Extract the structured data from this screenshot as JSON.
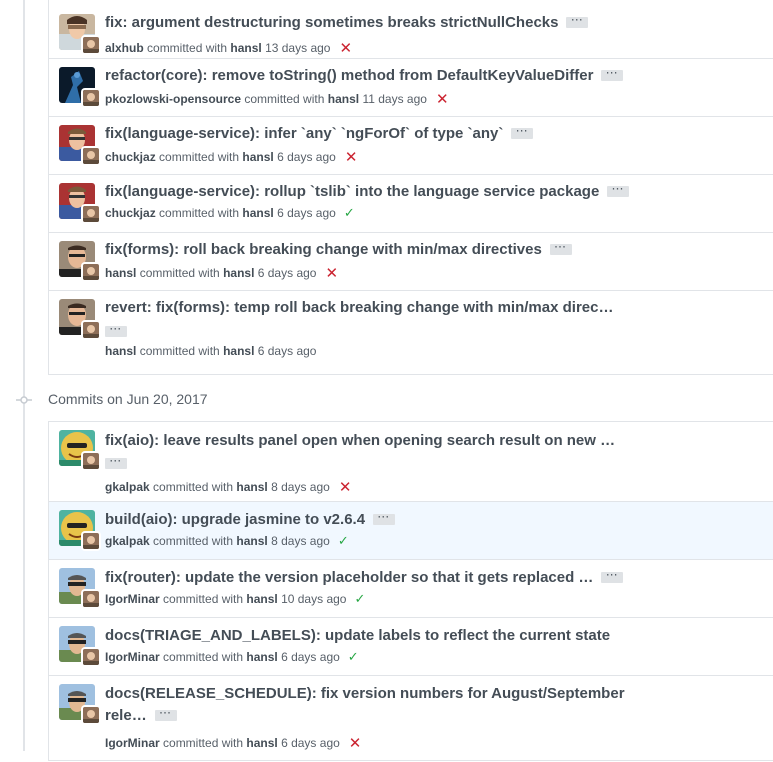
{
  "date_heading": "Commits on Jun 20, 2017",
  "commits_before": [
    {
      "title": "fix: argument destructuring sometimes breaks strictNullChecks",
      "author": "alxhub",
      "committed_with": "committed with",
      "committer": "hansl",
      "time": "13 days ago",
      "status": "fail",
      "avatar": "alxhub"
    },
    {
      "title": "refactor(core): remove toString() method from DefaultKeyValueDiffer",
      "author": "pkozlowski-opensource",
      "committed_with": "committed with",
      "committer": "hansl",
      "time": "11 days ago",
      "status": "fail",
      "avatar": "pkozlowski"
    },
    {
      "title": "fix(language-service): infer `any` `ngForOf` of type `any`",
      "author": "chuckjaz",
      "committed_with": "committed with",
      "committer": "hansl",
      "time": "6 days ago",
      "status": "fail",
      "avatar": "chuckjaz"
    },
    {
      "title": "fix(language-service): rollup `tslib` into the language service package",
      "author": "chuckjaz",
      "committed_with": "committed with",
      "committer": "hansl",
      "time": "6 days ago",
      "status": "success",
      "avatar": "chuckjaz"
    },
    {
      "title": "fix(forms): roll back breaking change with min/max directives",
      "author": "hansl",
      "committed_with": "committed with",
      "committer": "hansl",
      "time": "6 days ago",
      "status": "fail",
      "avatar": "hansl"
    },
    {
      "title": "revert: fix(forms): temp roll back breaking change with min/max direc…",
      "author": "hansl",
      "committed_with": "committed with",
      "committer": "hansl",
      "time": "6 days ago",
      "status": "none",
      "avatar": "hansl"
    }
  ],
  "commits_jun20": [
    {
      "title": "fix(aio): leave results panel open when opening search result on new …",
      "author": "gkalpak",
      "committed_with": "committed with",
      "committer": "hansl",
      "time": "8 days ago",
      "status": "fail",
      "avatar": "gkalpak"
    },
    {
      "title": "build(aio): upgrade jasmine to v2.6.4",
      "author": "gkalpak",
      "committed_with": "committed with",
      "committer": "hansl",
      "time": "8 days ago",
      "status": "success",
      "avatar": "gkalpak"
    },
    {
      "title": "fix(router): update the version placeholder so that it gets replaced …",
      "author": "IgorMinar",
      "committed_with": "committed with",
      "committer": "hansl",
      "time": "10 days ago",
      "status": "success",
      "avatar": "igor"
    },
    {
      "title": "docs(TRIAGE_AND_LABELS): update labels to reflect the current state",
      "author": "IgorMinar",
      "committed_with": "committed with",
      "committer": "hansl",
      "time": "6 days ago",
      "status": "success",
      "avatar": "igor"
    },
    {
      "title_line1": "docs(RELEASE_SCHEDULE): fix version numbers for August/September",
      "title_line2": "rele…",
      "author": "IgorMinar",
      "committed_with": "committed with",
      "committer": "hansl",
      "time": "6 days ago",
      "status": "fail",
      "avatar": "igor"
    }
  ],
  "ellipsis_label": "···",
  "status_icons": {
    "fail": "✕",
    "success": "✓"
  },
  "colors": {
    "fail": "#cb2431",
    "success": "#28a745",
    "highlight": "#f1f8ff"
  }
}
